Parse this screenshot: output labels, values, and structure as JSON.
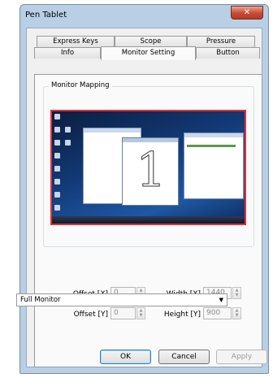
{
  "window": {
    "title": "Pen Tablet"
  },
  "tabs_row1": [
    "Express Keys",
    "Scope",
    "Pressure"
  ],
  "tabs_row2": [
    "Info",
    "Monitor Setting",
    "Button"
  ],
  "active_tab": "Monitor Setting",
  "monitor_mapping": {
    "legend": "Monitor Mapping",
    "preview_number": "1"
  },
  "fields": {
    "offset_x": {
      "label": "Offset [X]",
      "value": "0"
    },
    "offset_y": {
      "label": "Offset [Y]",
      "value": "0"
    },
    "width_x": {
      "label": "Width [X]",
      "value": "1440"
    },
    "height_y": {
      "label": "Height [Y]",
      "value": "900"
    }
  },
  "monitor_select": {
    "value": "Full Monitor"
  },
  "buttons": {
    "ok": "OK",
    "cancel": "Cancel",
    "apply": "Apply"
  },
  "colors": {
    "mapping_border": "#e0303a",
    "titlebar": "#b8cfe6",
    "close_button": "#c64b33"
  },
  "icons": {
    "close": "close-icon",
    "dropdown": "chevron-down-icon",
    "spin_up": "spin-up-icon",
    "spin_down": "spin-down-icon"
  }
}
